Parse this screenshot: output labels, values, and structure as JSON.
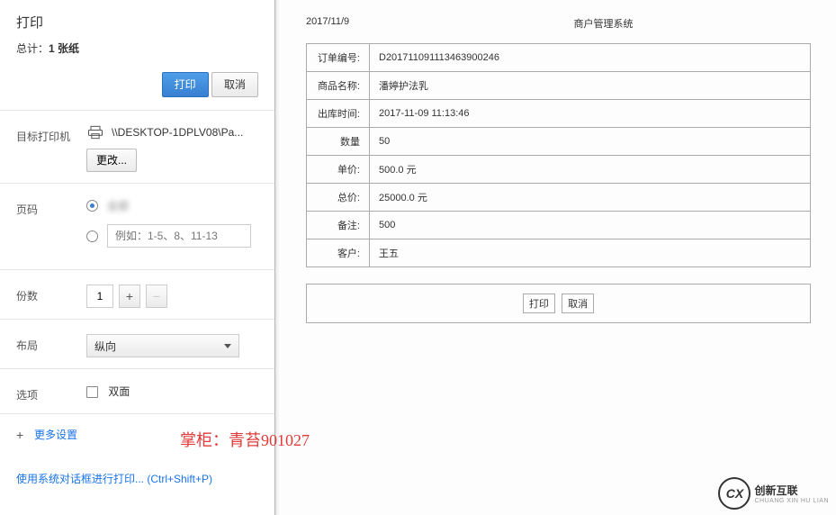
{
  "dialog": {
    "title": "打印",
    "subtotal_prefix": "总计：",
    "subtotal_count": "1 张纸",
    "print_btn": "打印",
    "cancel_btn": "取消"
  },
  "printer": {
    "section_label": "目标打印机",
    "name": "\\\\DESKTOP-1DPLV08\\Pa...",
    "change_btn": "更改..."
  },
  "pages": {
    "section_label": "页码",
    "all_label": "全部",
    "custom_placeholder": "例如：1-5、8、11-13"
  },
  "copies": {
    "section_label": "份数",
    "value": "1"
  },
  "layout": {
    "section_label": "布局",
    "selected": "纵向"
  },
  "options": {
    "section_label": "选项",
    "duplex": "双面"
  },
  "more_settings": "更多设置",
  "system_dialog": "使用系统对话框进行打印... (Ctrl+Shift+P)",
  "preview": {
    "date": "2017/11/9",
    "title": "商户管理系统",
    "rows": {
      "order_no_label": "订单编号:",
      "order_no": "D201711091113463900246",
      "product_label": "商品名称:",
      "product": "潘婷护法乳",
      "out_time_label": "出库时间:",
      "out_time": "2017-11-09 11:13:46",
      "qty_label": "数量",
      "qty": "50",
      "price_label": "单价:",
      "price": "500.0 元",
      "total_label": "总价:",
      "total": "25000.0 元",
      "remark_label": "备注:",
      "remark": "500",
      "customer_label": "客户:",
      "customer": "王五"
    },
    "actions": {
      "print": "打印",
      "cancel": "取消"
    }
  },
  "watermark": "掌柜：青苔901027",
  "brand": {
    "abbr": "CX",
    "name": "创新互联",
    "sub": "CHUANG XIN HU LIAN"
  }
}
